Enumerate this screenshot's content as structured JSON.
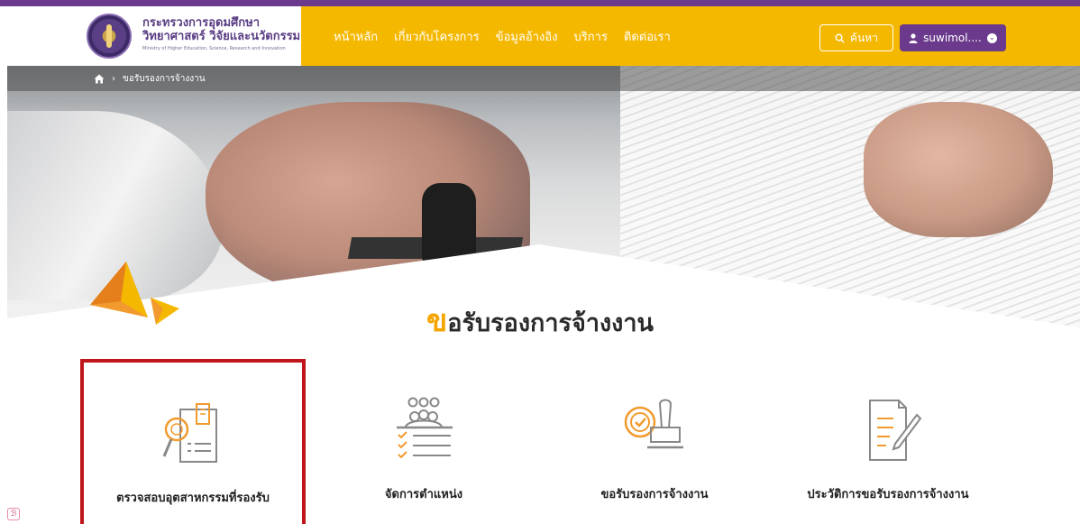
{
  "brand": {
    "line1": "กระทรวงการอุดมศึกษา",
    "line2": "วิทยาศาสตร์ วิจัยและนวัตกรรม",
    "line3": "Ministry of Higher Education, Science, Research and Innovation"
  },
  "nav": {
    "items": [
      {
        "label": "หน้าหลัก"
      },
      {
        "label": "เกี่ยวกับโครงการ"
      },
      {
        "label": "ข้อมูลอ้างอิง"
      },
      {
        "label": "บริการ"
      },
      {
        "label": "ติดต่อเรา"
      }
    ]
  },
  "search": {
    "label": "ค้นหา",
    "icon": "search-icon"
  },
  "user": {
    "label": "suwimol....",
    "icon": "user-icon",
    "caret": "chevron-down-icon"
  },
  "breadcrumb": {
    "home_icon": "home-icon",
    "separator": "›",
    "current": "ขอรับรองการจ้างงาน"
  },
  "title": {
    "accent": "ข",
    "rest": "อรับรองการจ้างงาน"
  },
  "cards": [
    {
      "label": "ตรวจสอบอุตสาหกรรมที่รองรับ",
      "icon": "document-search-icon",
      "selected": true
    },
    {
      "label": "จัดการตำแหน่ง",
      "icon": "team-checklist-icon",
      "selected": false
    },
    {
      "label": "ขอรับรองการจ้างงาน",
      "icon": "approval-stamp-icon",
      "selected": false
    },
    {
      "label": "ประวัติการขอรับรองการจ้างงาน",
      "icon": "document-edit-icon",
      "selected": false
    }
  ],
  "colors": {
    "brand_yellow": "#f5b800",
    "brand_purple": "#6b3a8c",
    "icon_orange": "#f29a2e",
    "highlight_red": "#c0161b"
  }
}
